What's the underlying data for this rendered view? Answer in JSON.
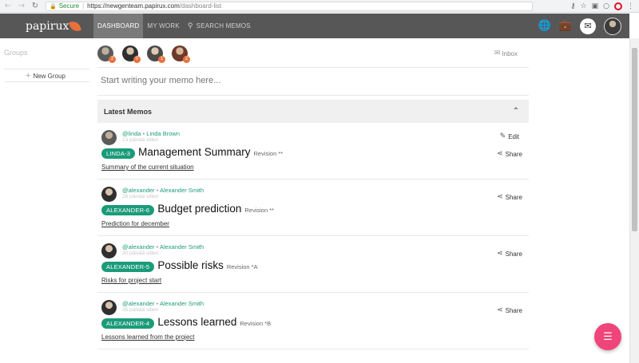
{
  "browser": {
    "secure_label": "Secure",
    "url_host": "https://newgenteam.papirux.com",
    "url_path": "/dashboard-list"
  },
  "app": {
    "logo_text": "papirux",
    "tabs": [
      {
        "label": "DASHBOARD",
        "active": true
      },
      {
        "label": "MY WORK",
        "active": false
      },
      {
        "label": "SEARCH MEMOS",
        "active": false,
        "icon": "search-icon"
      }
    ]
  },
  "sidebar": {
    "groups_title": "Groups",
    "new_group_label": "New Group"
  },
  "members": [
    {
      "name": "member-1",
      "badge": "2",
      "color": "#5a5a5a"
    },
    {
      "name": "member-2",
      "badge": "0",
      "color": "#3b3b3b"
    },
    {
      "name": "member-3",
      "badge": "1",
      "color": "#4a4a4a"
    },
    {
      "name": "member-4",
      "badge": "2",
      "color": "#6b3a2a"
    }
  ],
  "inbox_label": "Inbox",
  "memo_input_placeholder": "Start writing your memo here...",
  "latest_memos_title": "Latest Memos",
  "memos": [
    {
      "handle": "@linda",
      "name": "Linda Brown",
      "ago": "13 päivää sitten",
      "tag": "LINDA-3",
      "title": "Management Summary",
      "revision": "Revision **",
      "subtitle": "Summary of the current situation",
      "edit": "Edit",
      "share": "Share"
    },
    {
      "handle": "@alexander",
      "name": "Alexander Smith",
      "ago": "28 päivää sitten",
      "tag": "ALEXANDER-6",
      "title": "Budget prediction",
      "revision": "Revision **",
      "subtitle": "Prediction for december",
      "share": "Share"
    },
    {
      "handle": "@alexander",
      "name": "Alexander Smith",
      "ago": "30 päivää sitten",
      "tag": "ALEXANDER-5",
      "title": "Possible risks",
      "revision": "Revision *A",
      "subtitle": "Risks for project start",
      "share": "Share"
    },
    {
      "handle": "@alexander",
      "name": "Alexander Smith",
      "ago": "35 päivää sitten",
      "tag": "ALEXANDER-4",
      "title": "Lessons learned",
      "revision": "Revision *B",
      "subtitle": "Lessons learned from the project",
      "share": "Share"
    }
  ]
}
